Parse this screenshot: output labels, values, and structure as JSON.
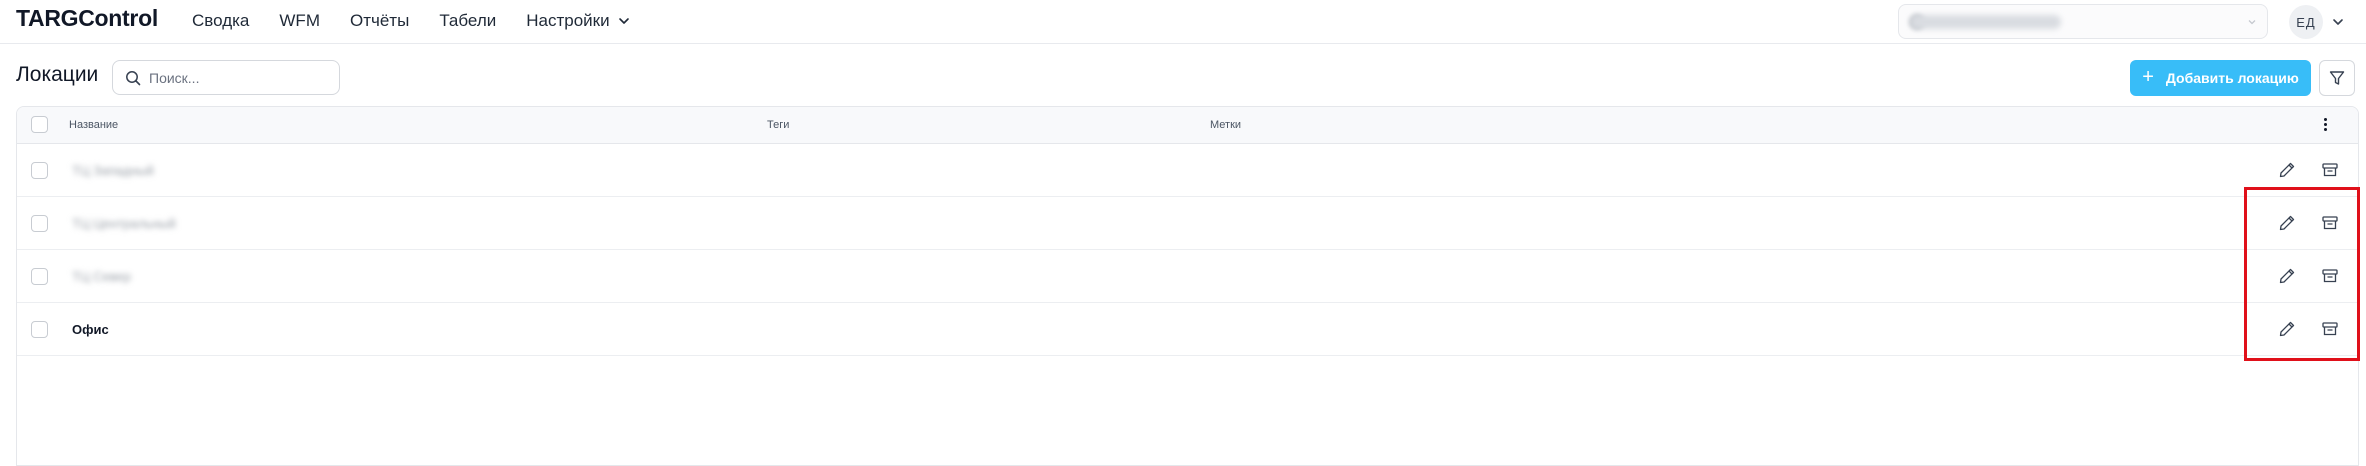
{
  "app": {
    "title": "TARGControl"
  },
  "nav": {
    "items": [
      "Сводка",
      "WFM",
      "Отчёты",
      "Табели",
      "Настройки"
    ]
  },
  "header": {
    "avatar_initials": "ЕД"
  },
  "page": {
    "title": "Локации",
    "search_placeholder": "Поиск...",
    "add_button_label": "Добавить локацию"
  },
  "table": {
    "columns": {
      "name": "Название",
      "tags": "Теги",
      "marks": "Метки"
    },
    "rows": [
      {
        "name": "ТЦ Западный",
        "blurred": true
      },
      {
        "name": "ТЦ Центральный",
        "blurred": true
      },
      {
        "name": "ТЦ Север",
        "blurred": true
      },
      {
        "name": "Офис",
        "blurred": false
      }
    ]
  },
  "icons": {
    "search": "search-icon",
    "add": "plus-icon",
    "filter": "filter-icon",
    "menu": "more-vertical-icon",
    "edit": "pencil-icon",
    "archive": "archive-icon",
    "dropdown": "chevron-down-icon"
  },
  "colors": {
    "accent": "#38bdf8",
    "highlight": "#e0101a"
  }
}
